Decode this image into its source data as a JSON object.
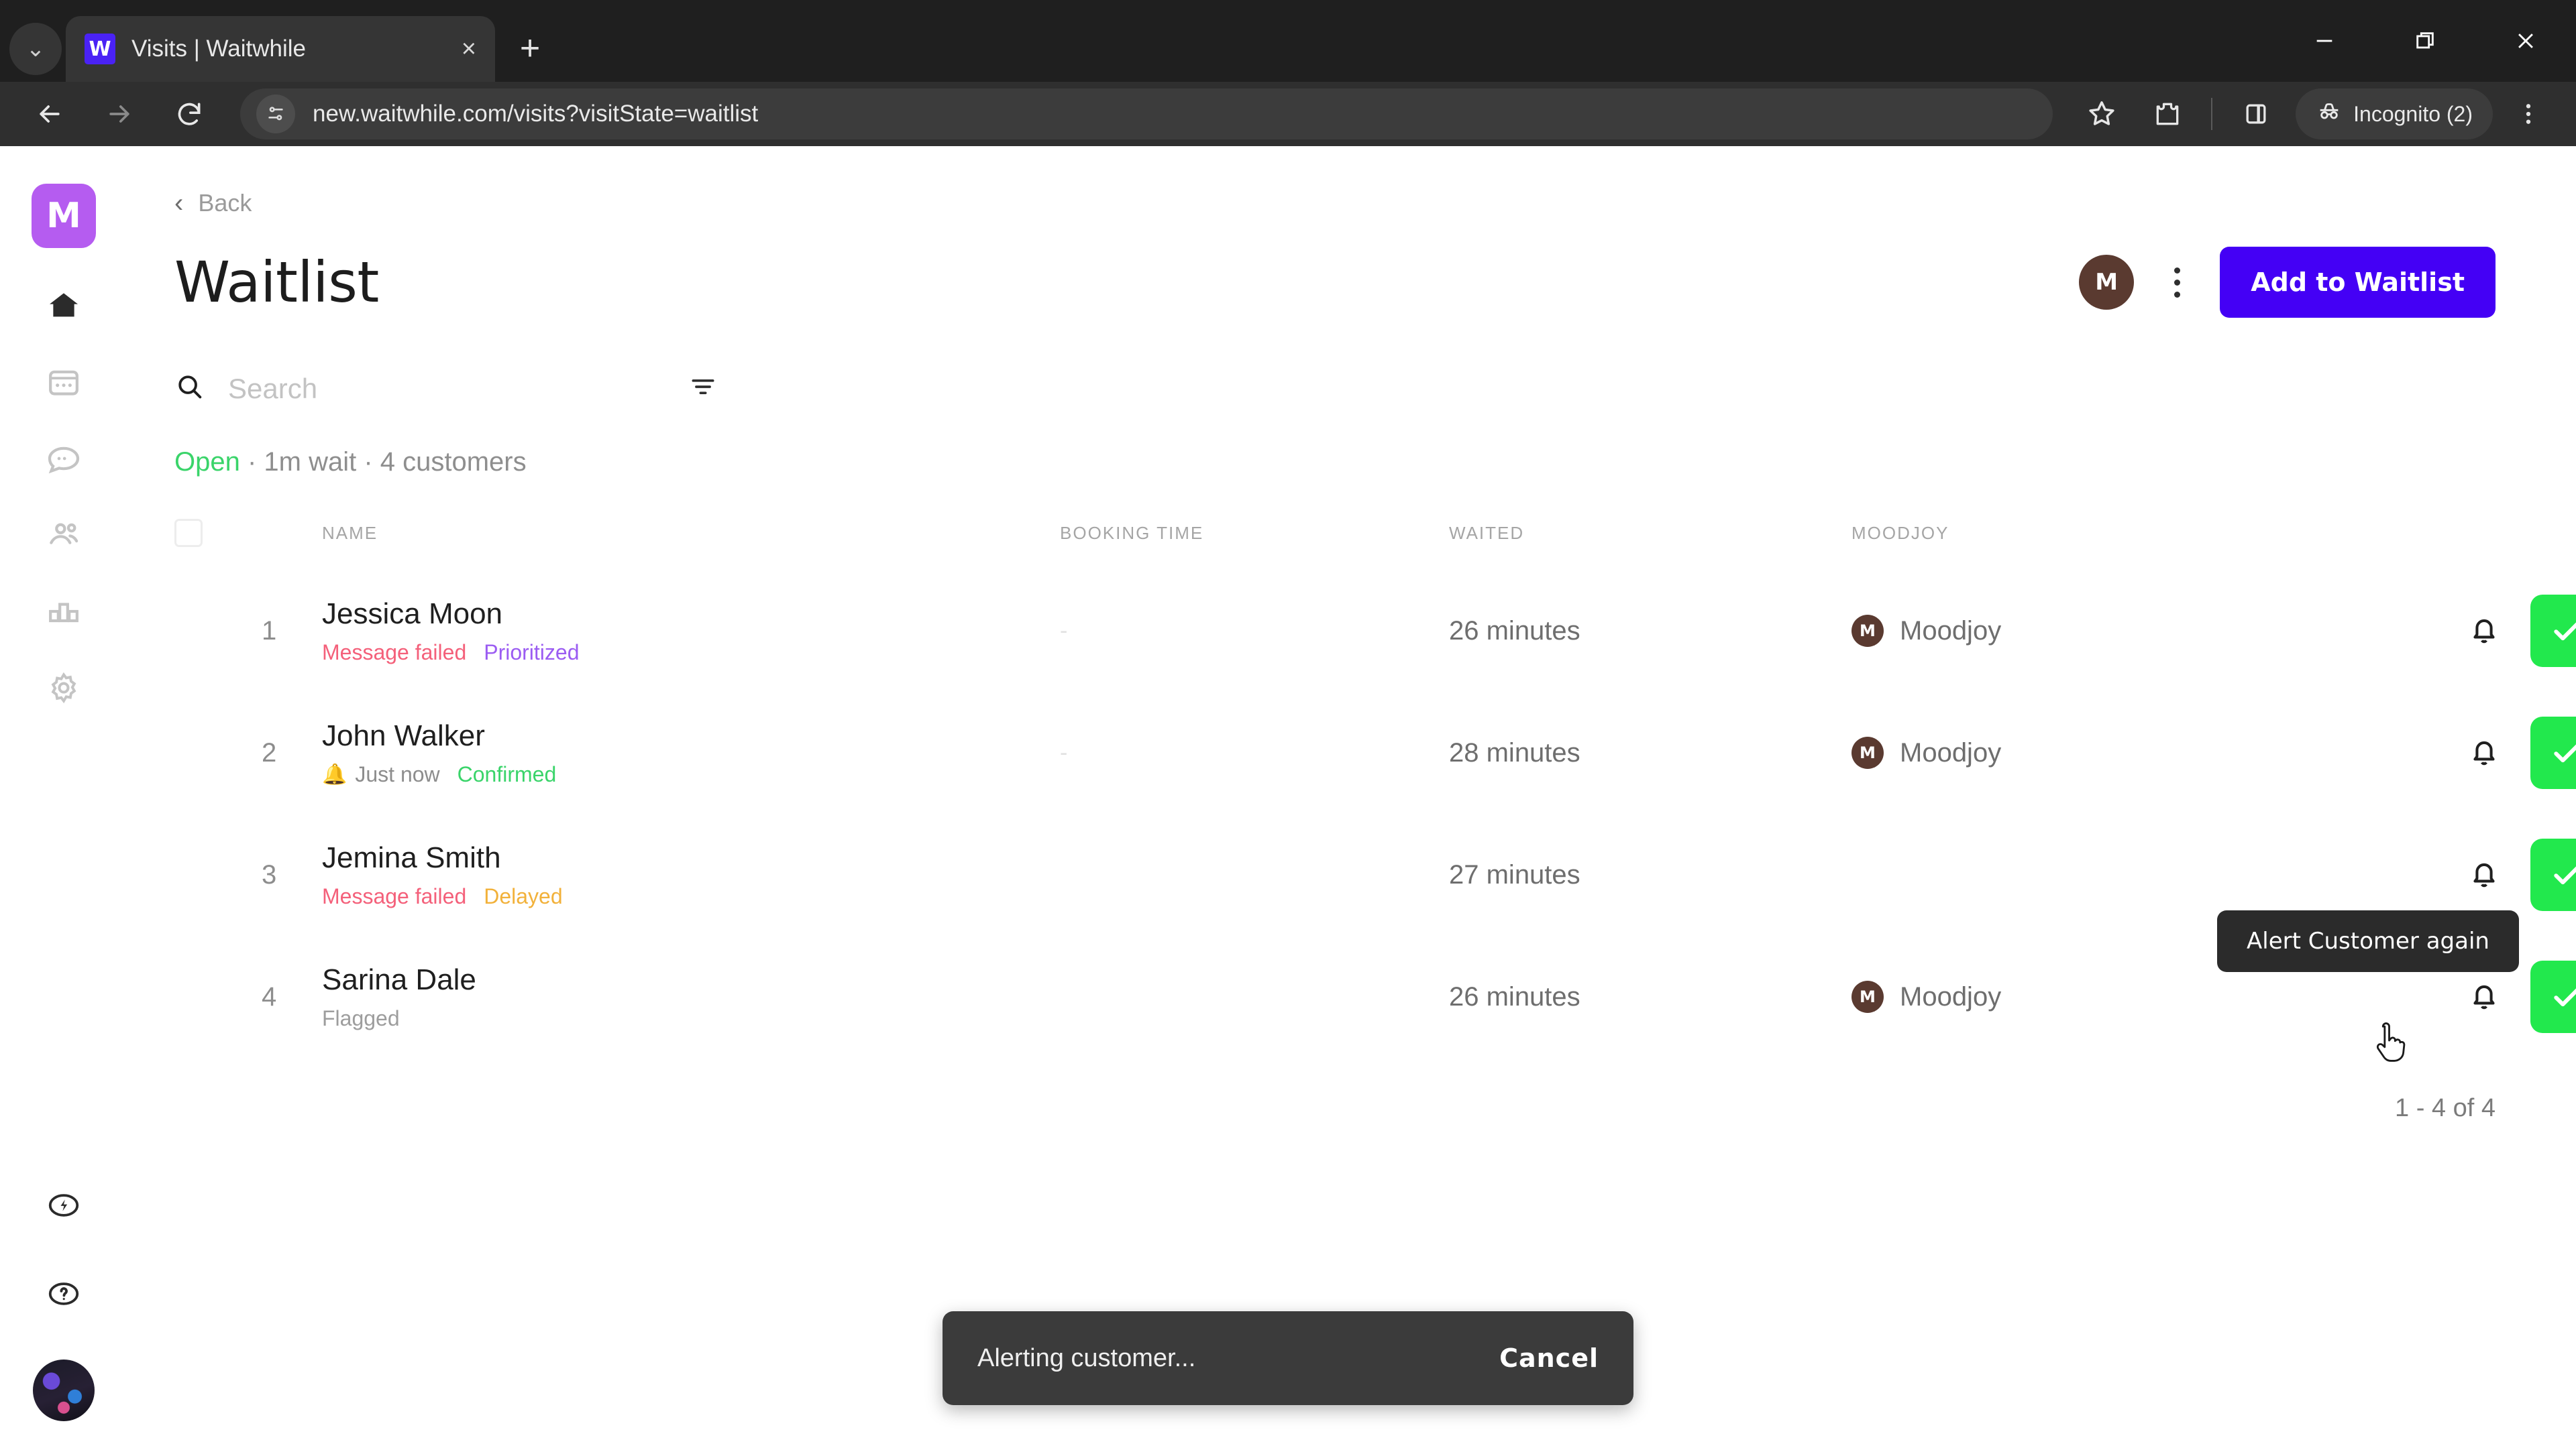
{
  "browser": {
    "tab": {
      "title": "Visits | Waitwhile",
      "favicon_letter": "W",
      "close_label": "×"
    },
    "tab_search_label": "⌄",
    "new_tab_label": "+",
    "window_controls": {
      "minimize": "—",
      "maximize": "❐",
      "close": "✕"
    },
    "nav": {
      "back": "←",
      "forward": "→",
      "reload": "⟳"
    },
    "omnibox": {
      "url": "new.waitwhile.com/visits?visitState=waitlist",
      "site_info_icon": "tune-icon"
    },
    "toolbar": {
      "bookmark_icon": "star-icon",
      "extensions_icon": "extensions-icon",
      "sidepanel_icon": "side-panel-icon",
      "profile_label": "Incognito (2)",
      "menu_icon": "three-dot-menu-icon"
    }
  },
  "sidebar": {
    "logo_letter": "M",
    "items": [
      {
        "name": "home",
        "icon": "home-icon",
        "active": true
      },
      {
        "name": "calendar",
        "icon": "calendar-icon",
        "active": false
      },
      {
        "name": "messages",
        "icon": "chat-bubble-icon",
        "active": false
      },
      {
        "name": "customers",
        "icon": "people-icon",
        "active": false
      },
      {
        "name": "analytics",
        "icon": "bar-chart-icon",
        "active": false
      },
      {
        "name": "settings",
        "icon": "gear-icon",
        "active": false
      }
    ],
    "bottom_items": [
      {
        "name": "power",
        "icon": "lightning-circle-icon"
      },
      {
        "name": "help",
        "icon": "question-circle-icon"
      },
      {
        "name": "account",
        "icon": "user-avatar-photo"
      }
    ]
  },
  "page": {
    "back_label": "Back",
    "title": "Waitlist",
    "header_avatar_letter": "M",
    "add_button_label": "Add to Waitlist"
  },
  "search": {
    "placeholder": "Search",
    "value": "",
    "filter_icon": "filter-icon"
  },
  "status": {
    "open": "Open",
    "rest": " · 1m wait · 4 customers"
  },
  "table": {
    "headers": {
      "name": "NAME",
      "booking_time": "BOOKING TIME",
      "waited": "WAITED",
      "moodjoy": "MOODJOY"
    },
    "rows": [
      {
        "num": "1",
        "name": "Jessica Moon",
        "tags": [
          {
            "label": "Message failed",
            "style": "tag-failed"
          },
          {
            "label": "Prioritized",
            "style": "tag-prior"
          }
        ],
        "booking_time": "-",
        "waited": "26 minutes",
        "moodjoy": "Moodjoy",
        "moodjoy_avatar": "M",
        "bell_icon": "bell-icon",
        "check_icon": "check-icon"
      },
      {
        "num": "2",
        "name": "John Walker",
        "tags": [
          {
            "label": "Just now",
            "style": "tag-justnow",
            "bell": true
          },
          {
            "label": "Confirmed",
            "style": "tag-confirm"
          }
        ],
        "booking_time": "-",
        "waited": "28 minutes",
        "moodjoy": "Moodjoy",
        "moodjoy_avatar": "M",
        "bell_icon": "bell-icon",
        "check_icon": "check-icon"
      },
      {
        "num": "3",
        "name": "Jemina Smith",
        "tags": [
          {
            "label": "Message failed",
            "style": "tag-failed"
          },
          {
            "label": "Delayed",
            "style": "tag-delayed"
          }
        ],
        "booking_time": "",
        "waited": "27 minutes",
        "moodjoy": "",
        "moodjoy_avatar": "",
        "bell_icon": "bell-icon",
        "check_icon": "check-icon"
      },
      {
        "num": "4",
        "name": "Sarina Dale",
        "tags": [
          {
            "label": "Flagged",
            "style": "tag-flagged"
          }
        ],
        "booking_time": "",
        "waited": "26 minutes",
        "moodjoy": "Moodjoy",
        "moodjoy_avatar": "M",
        "bell_icon": "bell-icon",
        "check_icon": "check-icon"
      }
    ]
  },
  "pagination": {
    "label": "1 - 4 of 4"
  },
  "tooltip": {
    "text": "Alert Customer again"
  },
  "toast": {
    "message": "Alerting customer...",
    "action": "Cancel"
  },
  "colors": {
    "accent": "#4400f5",
    "logo": "#b55cf0",
    "green": "#22e84d",
    "status_open": "#3ad46a",
    "tag_failed": "#f4607a",
    "tag_prioritized": "#9b5cf2",
    "tag_delayed": "#f2b13a",
    "avatar_brown": "#5a3a30"
  }
}
